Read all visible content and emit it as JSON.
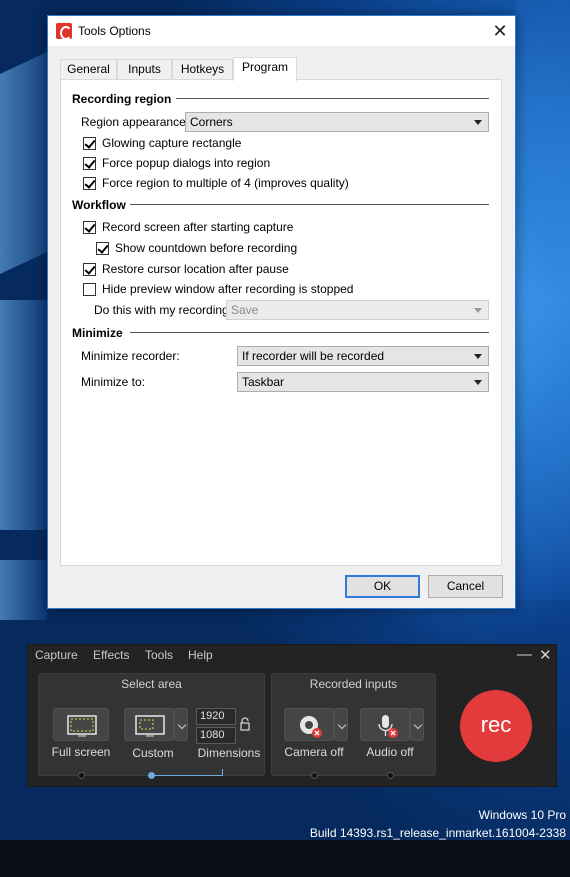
{
  "dialog": {
    "title": "Tools Options",
    "close_glyph": "✕",
    "tabs": [
      "General",
      "Inputs",
      "Hotkeys",
      "Program"
    ],
    "active_tab": "Program",
    "recording_region": {
      "heading": "Recording region",
      "appearance_label": "Region appearance:",
      "appearance_value": "Corners",
      "checkboxes": [
        {
          "label": "Glowing capture rectangle",
          "checked": true
        },
        {
          "label": "Force popup dialogs into region",
          "checked": true
        },
        {
          "label": "Force region to multiple of 4 (improves quality)",
          "checked": true
        }
      ]
    },
    "workflow": {
      "heading": "Workflow",
      "checkboxes": [
        {
          "label": "Record screen after starting capture",
          "checked": true
        },
        {
          "label": "Show countdown before recording",
          "checked": true
        },
        {
          "label": "Restore cursor location after pause",
          "checked": true
        },
        {
          "label": "Hide preview window after recording is stopped",
          "checked": false
        }
      ],
      "do_this_label": "Do this with my recording:",
      "do_this_value": "Save"
    },
    "minimize": {
      "heading": "Minimize",
      "recorder_label": "Minimize recorder:",
      "recorder_value": "If recorder will be recorded",
      "to_label": "Minimize to:",
      "to_value": "Taskbar"
    },
    "ok_label": "OK",
    "cancel_label": "Cancel"
  },
  "recorder": {
    "menu": [
      "Capture",
      "Effects",
      "Tools",
      "Help"
    ],
    "minimize_glyph": "—",
    "close_glyph": "✕",
    "select_area": {
      "title": "Select area",
      "full_screen": "Full screen",
      "custom": "Custom",
      "width": "1920",
      "height": "1080",
      "dimensions": "Dimensions"
    },
    "recorded_inputs": {
      "title": "Recorded inputs",
      "camera": "Camera off",
      "audio": "Audio off"
    },
    "rec_label": "rec",
    "colors": {
      "rec": "#e33b3b",
      "panel": "#232323",
      "accent": "#6ea9e0"
    }
  },
  "desktop": {
    "os_name": "Windows 10 Pro",
    "build": "Build 14393.rs1_release_inmarket.161004-2338"
  }
}
